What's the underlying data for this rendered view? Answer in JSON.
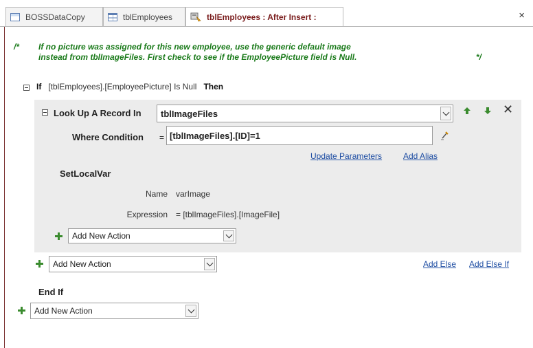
{
  "tabs": [
    {
      "label": "BOSSDataCopy",
      "icon": "form-icon"
    },
    {
      "label": "tblEmployees",
      "icon": "table-icon"
    },
    {
      "label": "tblEmployees : After Insert :",
      "icon": "data-macro-icon",
      "active": true
    }
  ],
  "window": {
    "close": "×"
  },
  "comment": {
    "open_mark": "/*",
    "line1": "If no picture was assigned for this new employee, use the generic default image",
    "line2": "instead from tblImageFiles. First check to see if the EmployeePicture field is Null.",
    "close_mark": "*/"
  },
  "if_block": {
    "keyword": "If",
    "condition": "[tblEmployees].[EmployeePicture] Is Null",
    "then": "Then",
    "end": "End If"
  },
  "lookup": {
    "label": "Look Up A Record In",
    "table": "tblImageFiles",
    "where_label": "Where Condition",
    "equals": "=",
    "where_value": "[tblImageFiles].[ID]=1",
    "update_parameters": "Update Parameters",
    "add_alias": "Add Alias",
    "delete": "✕"
  },
  "setlocalvar": {
    "action": "SetLocalVar",
    "name_label": "Name",
    "name_value": "varImage",
    "expression_label": "Expression",
    "expression_value": "= [tblImageFiles].[ImageFile]"
  },
  "add_new_action": {
    "inner": "Add New Action",
    "if_level": "Add New Action",
    "top_level": "Add New Action"
  },
  "if_links": {
    "add_else": "Add Else",
    "add_else_if": "Add Else If"
  },
  "colors": {
    "comment": "#1a7a1a",
    "active_tab_text": "#7a1d1d",
    "link": "#1f4ea3",
    "plus": "#3a8b2e",
    "block_bg": "#ececec"
  }
}
